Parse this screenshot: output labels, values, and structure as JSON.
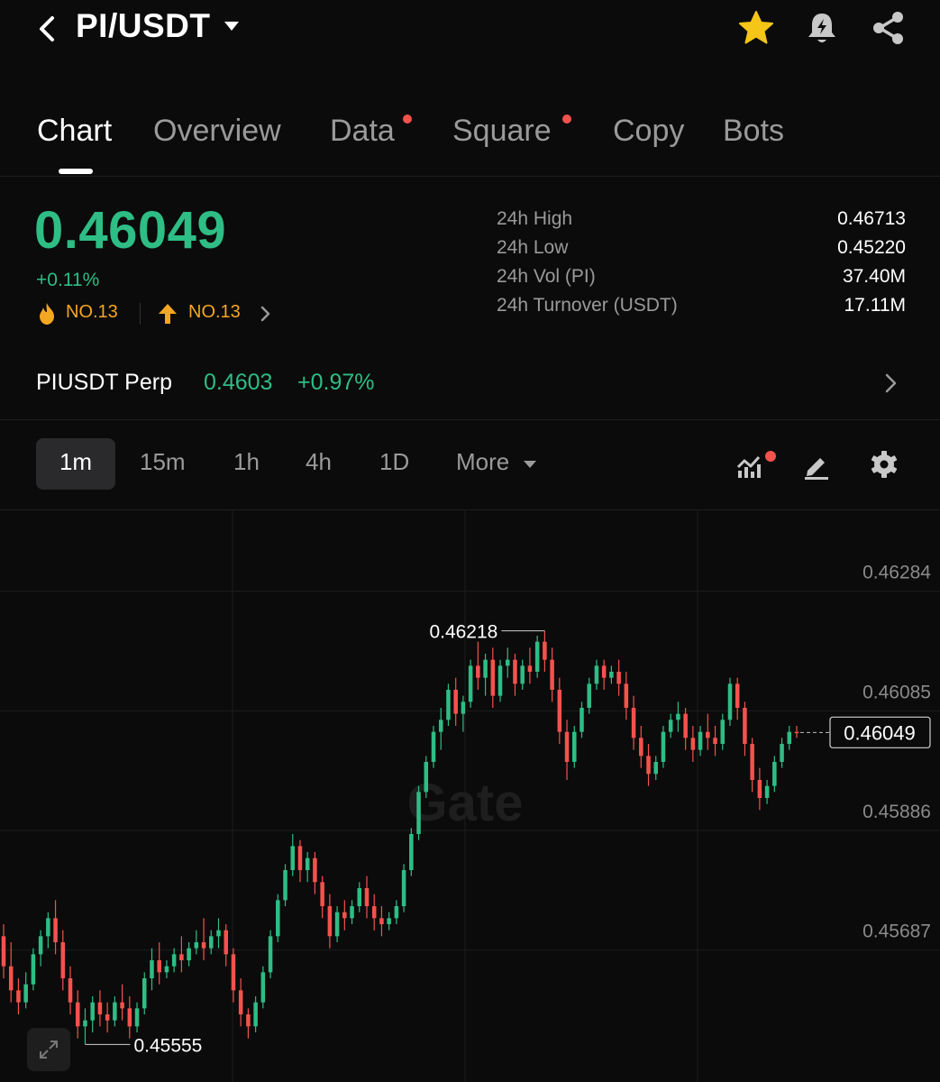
{
  "header": {
    "pair": "PI/USDT",
    "icons": [
      "back-icon",
      "caret-down-icon",
      "star-icon",
      "price-alert-icon",
      "share-icon"
    ],
    "star_color": "#f5c518"
  },
  "tabs": [
    {
      "label": "Chart",
      "active": true,
      "dot": false
    },
    {
      "label": "Overview",
      "active": false,
      "dot": false
    },
    {
      "label": "Data",
      "active": false,
      "dot": true
    },
    {
      "label": "Square",
      "active": false,
      "dot": true
    },
    {
      "label": "Copy",
      "active": false,
      "dot": false
    },
    {
      "label": "Bots",
      "active": false,
      "dot": false
    }
  ],
  "ticker": {
    "last_price": "0.46049",
    "change": "+0.11%",
    "rank_hot": "NO.13",
    "rank_gainer": "NO.13",
    "up_color": "#2ebd85",
    "down_color": "#f4524d",
    "stats": [
      {
        "label": "24h High",
        "value": "0.46713"
      },
      {
        "label": "24h Low",
        "value": "0.45220"
      },
      {
        "label": "24h Vol (PI)",
        "value": "37.40M"
      },
      {
        "label": "24h Turnover (USDT)",
        "value": "17.11M"
      }
    ]
  },
  "perp": {
    "name": "PIUSDT Perp",
    "price": "0.4603",
    "change": "+0.97%"
  },
  "intervals": {
    "items": [
      "1m",
      "15m",
      "1h",
      "4h",
      "1D"
    ],
    "active": "1m",
    "more_label": "More",
    "tool_icons": [
      "indicators-icon",
      "draw-icon",
      "settings-icon"
    ]
  },
  "chart_data": {
    "type": "candlestick",
    "y_ticks": [
      "0.46284",
      "0.46085",
      "0.45886",
      "0.45687"
    ],
    "ylim": [
      0.4549,
      0.4639
    ],
    "high_label": "0.46218",
    "low_label": "0.45555",
    "current_price_label": "0.46049",
    "watermark": "Gate",
    "candles": [
      [
        0.4571,
        0.4573,
        0.4566,
        0.4564
      ],
      [
        0.4566,
        0.457,
        0.4562,
        0.456
      ],
      [
        0.4562,
        0.4564,
        0.456,
        0.4558
      ],
      [
        0.456,
        0.4565,
        0.4563,
        0.4559
      ],
      [
        0.4563,
        0.4569,
        0.4568,
        0.4562
      ],
      [
        0.4568,
        0.4572,
        0.4571,
        0.4566
      ],
      [
        0.4571,
        0.4575,
        0.4574,
        0.4569
      ],
      [
        0.4574,
        0.4577,
        0.457,
        0.4568
      ],
      [
        0.457,
        0.4572,
        0.4564,
        0.4562
      ],
      [
        0.4564,
        0.4566,
        0.456,
        0.4558
      ],
      [
        0.456,
        0.4562,
        0.4556,
        0.4554
      ],
      [
        0.4556,
        0.4559,
        0.4557,
        0.4553
      ],
      [
        0.4557,
        0.4561,
        0.456,
        0.4555
      ],
      [
        0.456,
        0.4562,
        0.4558,
        0.4556
      ],
      [
        0.4558,
        0.456,
        0.4557,
        0.4555
      ],
      [
        0.4557,
        0.4561,
        0.456,
        0.4556
      ],
      [
        0.456,
        0.4563,
        0.4559,
        0.4557
      ],
      [
        0.4559,
        0.4561,
        0.4556,
        0.4554
      ],
      [
        0.4556,
        0.456,
        0.4559,
        0.4555
      ],
      [
        0.4559,
        0.4565,
        0.4564,
        0.4558
      ],
      [
        0.4564,
        0.4569,
        0.4567,
        0.4562
      ],
      [
        0.4567,
        0.457,
        0.4565,
        0.4563
      ],
      [
        0.4565,
        0.4567,
        0.4566,
        0.4564
      ],
      [
        0.4566,
        0.4569,
        0.4568,
        0.4565
      ],
      [
        0.4568,
        0.4571,
        0.4567,
        0.4565
      ],
      [
        0.4567,
        0.457,
        0.4569,
        0.4566
      ],
      [
        0.4569,
        0.4572,
        0.457,
        0.4568
      ],
      [
        0.457,
        0.4574,
        0.4569,
        0.4567
      ],
      [
        0.4569,
        0.4572,
        0.4571,
        0.4568
      ],
      [
        0.4571,
        0.4574,
        0.4572,
        0.4569
      ],
      [
        0.4572,
        0.4573,
        0.4568,
        0.4566
      ],
      [
        0.4568,
        0.4569,
        0.4562,
        0.456
      ],
      [
        0.4562,
        0.4564,
        0.4558,
        0.4556
      ],
      [
        0.4558,
        0.4559,
        0.4556,
        0.4554
      ],
      [
        0.4556,
        0.4561,
        0.456,
        0.4555
      ],
      [
        0.456,
        0.4566,
        0.4565,
        0.4559
      ],
      [
        0.4565,
        0.4572,
        0.4571,
        0.4564
      ],
      [
        0.4571,
        0.4578,
        0.4577,
        0.457
      ],
      [
        0.4577,
        0.4583,
        0.4582,
        0.4576
      ],
      [
        0.4582,
        0.4588,
        0.4586,
        0.4581
      ],
      [
        0.4586,
        0.4587,
        0.4582,
        0.458
      ],
      [
        0.4582,
        0.4585,
        0.4584,
        0.458
      ],
      [
        0.4584,
        0.4585,
        0.458,
        0.4578
      ],
      [
        0.458,
        0.4581,
        0.4576,
        0.4574
      ],
      [
        0.4576,
        0.4578,
        0.4571,
        0.4569
      ],
      [
        0.4571,
        0.4576,
        0.4575,
        0.457
      ],
      [
        0.4575,
        0.4577,
        0.4574,
        0.4572
      ],
      [
        0.4574,
        0.4577,
        0.4576,
        0.4573
      ],
      [
        0.4576,
        0.458,
        0.4579,
        0.4575
      ],
      [
        0.4579,
        0.4581,
        0.4576,
        0.4574
      ],
      [
        0.4576,
        0.4578,
        0.4574,
        0.4572
      ],
      [
        0.4574,
        0.4576,
        0.4573,
        0.4571
      ],
      [
        0.4573,
        0.4575,
        0.4574,
        0.4572
      ],
      [
        0.4574,
        0.4577,
        0.4576,
        0.4573
      ],
      [
        0.4576,
        0.4583,
        0.4582,
        0.4575
      ],
      [
        0.4582,
        0.4589,
        0.4588,
        0.4581
      ],
      [
        0.4588,
        0.4596,
        0.4595,
        0.4587
      ],
      [
        0.4595,
        0.4601,
        0.46,
        0.4594
      ],
      [
        0.46,
        0.4606,
        0.4605,
        0.4599
      ],
      [
        0.4605,
        0.4609,
        0.4607,
        0.4602
      ],
      [
        0.4607,
        0.4613,
        0.4612,
        0.4606
      ],
      [
        0.4612,
        0.4614,
        0.4608,
        0.4606
      ],
      [
        0.4608,
        0.4611,
        0.461,
        0.4605
      ],
      [
        0.461,
        0.4617,
        0.4616,
        0.4609
      ],
      [
        0.4616,
        0.462,
        0.4614,
        0.4612
      ],
      [
        0.4614,
        0.4618,
        0.4617,
        0.4611
      ],
      [
        0.4617,
        0.4619,
        0.4611,
        0.4609
      ],
      [
        0.4611,
        0.4617,
        0.4616,
        0.461
      ],
      [
        0.4616,
        0.4619,
        0.4617,
        0.4614
      ],
      [
        0.4617,
        0.4618,
        0.4613,
        0.4611
      ],
      [
        0.4613,
        0.4617,
        0.4616,
        0.4612
      ],
      [
        0.4616,
        0.4619,
        0.4615,
        0.4613
      ],
      [
        0.4615,
        0.4621,
        0.462,
        0.4614
      ],
      [
        0.462,
        0.46218,
        0.4617,
        0.4615
      ],
      [
        0.4617,
        0.4619,
        0.4612,
        0.461
      ],
      [
        0.4612,
        0.4614,
        0.4605,
        0.4603
      ],
      [
        0.4605,
        0.4607,
        0.46,
        0.4597
      ],
      [
        0.46,
        0.4606,
        0.4605,
        0.4599
      ],
      [
        0.4605,
        0.461,
        0.4609,
        0.4604
      ],
      [
        0.4609,
        0.4614,
        0.4613,
        0.4608
      ],
      [
        0.4613,
        0.4617,
        0.4616,
        0.4612
      ],
      [
        0.4616,
        0.4617,
        0.4614,
        0.4612
      ],
      [
        0.4614,
        0.4616,
        0.4615,
        0.4613
      ],
      [
        0.4615,
        0.4617,
        0.4613,
        0.4611
      ],
      [
        0.4613,
        0.4615,
        0.4609,
        0.4607
      ],
      [
        0.4609,
        0.4611,
        0.4604,
        0.4602
      ],
      [
        0.4604,
        0.4606,
        0.4601,
        0.4599
      ],
      [
        0.4601,
        0.4603,
        0.4598,
        0.4596
      ],
      [
        0.4598,
        0.4601,
        0.46,
        0.4597
      ],
      [
        0.46,
        0.4606,
        0.4605,
        0.4599
      ],
      [
        0.4605,
        0.4608,
        0.4607,
        0.4604
      ],
      [
        0.4607,
        0.461,
        0.4608,
        0.4605
      ],
      [
        0.4608,
        0.4609,
        0.4604,
        0.4602
      ],
      [
        0.4604,
        0.4606,
        0.4602,
        0.46
      ],
      [
        0.4602,
        0.4606,
        0.4605,
        0.4601
      ],
      [
        0.4605,
        0.4608,
        0.4604,
        0.4602
      ],
      [
        0.4604,
        0.4606,
        0.4603,
        0.4601
      ],
      [
        0.4603,
        0.4608,
        0.4607,
        0.4602
      ],
      [
        0.4607,
        0.4614,
        0.4613,
        0.4606
      ],
      [
        0.4613,
        0.4614,
        0.4609,
        0.4607
      ],
      [
        0.4609,
        0.461,
        0.4603,
        0.4601
      ],
      [
        0.4603,
        0.4604,
        0.4597,
        0.4595
      ],
      [
        0.4597,
        0.4599,
        0.4594,
        0.4592
      ],
      [
        0.4594,
        0.4597,
        0.4596,
        0.4593
      ],
      [
        0.4596,
        0.4601,
        0.46,
        0.4595
      ],
      [
        0.46,
        0.4604,
        0.4603,
        0.4599
      ],
      [
        0.4603,
        0.4606,
        0.4605,
        0.4602
      ],
      [
        0.4605,
        0.4606,
        0.46049,
        0.4604
      ]
    ]
  }
}
